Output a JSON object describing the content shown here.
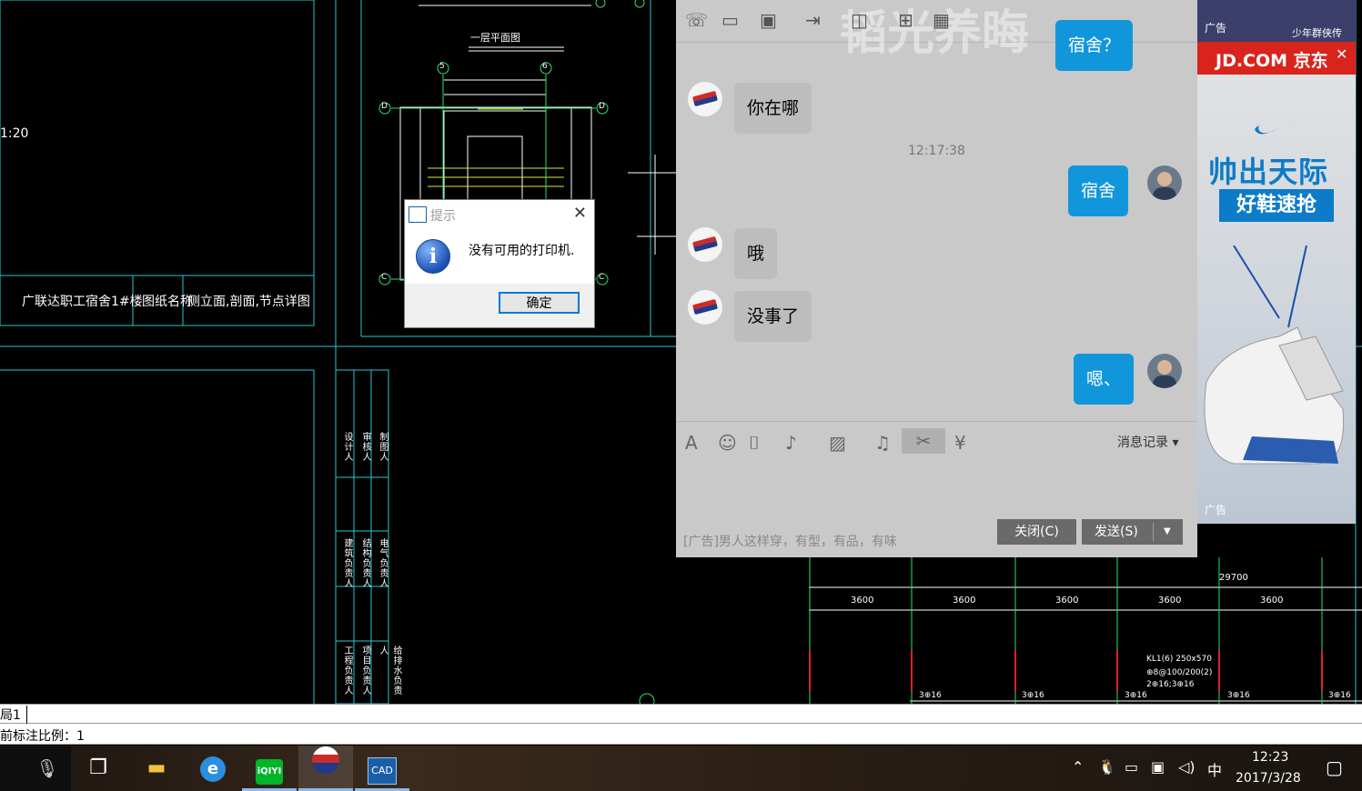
{
  "cad": {
    "scale_text": "1:20",
    "title_cell_1": "广联达职工宿舍1#楼",
    "title_cell_2": "图纸名称",
    "title_cell_3": "侧立面,剖面,节点详图",
    "plan_label": "一层平面图",
    "grid_axes": [
      "5",
      "6",
      "D",
      "D",
      "C",
      "C"
    ],
    "dims": [
      "3600",
      "3600",
      "3600",
      "3600",
      "3600"
    ],
    "total_dim": "29700",
    "beam_note": [
      "KL1(6) 250x570",
      "⊕8@100/200(2)",
      "2⊕16;3⊕16"
    ],
    "dim_small": [
      "3⊕16",
      "3⊕16",
      "3⊕16",
      "3⊕16",
      "3⊕16"
    ],
    "vertical_labels": [
      "设计人",
      "审核人",
      "制图人",
      "建筑负责人",
      "结构负责人",
      "电气负责人",
      "工程负责人",
      "项目负责人",
      "给排水负责人"
    ],
    "layout_tab": "局1",
    "command_line": "前标注比例：1"
  },
  "dialog": {
    "title": "提示",
    "message": "没有可用的打印机.",
    "ok_label": "确定",
    "app_icon": "cad-app-icon"
  },
  "chat": {
    "watermark": "韬光养晦",
    "top_bubble": "宿舍？",
    "messages": [
      {
        "side": "in",
        "text": "你在哪"
      },
      {
        "side": "out",
        "text": "宿舍"
      },
      {
        "side": "in",
        "text": "哦"
      },
      {
        "side": "in",
        "text": "没事了"
      },
      {
        "side": "out",
        "text": "嗯、"
      }
    ],
    "timestamp": "12:17:38",
    "toolbar_icons": [
      "phone-icon",
      "video-icon",
      "screen-share-icon",
      "file-transfer-icon",
      "remote-desktop-icon",
      "more-apps-icon",
      "add-app-icon"
    ],
    "input_icons": [
      "font-icon",
      "emoji-icon",
      "shake-icon",
      "voice-icon",
      "image-icon",
      "music-icon",
      "screenshot-icon",
      "red-packet-icon"
    ],
    "message_record_label": "消息记录",
    "ad_text": "[广告]男人这样穿，有型，有品，有味",
    "close_label": "关闭(C)",
    "send_label": "发送(S)"
  },
  "ad": {
    "top_label": "广告",
    "top_game": "少年群侠传",
    "jd_text": "JD.COM 京东",
    "slogan": "帅出天际",
    "cta": "好鞋速抢",
    "bottom_label": "广告",
    "brand_color": "#d9241d",
    "accent_color": "#0c7bc8"
  },
  "taskbar": {
    "apps": [
      "microphone-icon",
      "task-view-icon",
      "file-explorer-icon",
      "ie-icon",
      "iqiyi-icon",
      "qq-chat-icon",
      "cad-icon"
    ],
    "iqiyi_label": "iQIYI",
    "cad_label": "CAD",
    "ime": "中",
    "time": "12:23",
    "date": "2017/3/28"
  }
}
